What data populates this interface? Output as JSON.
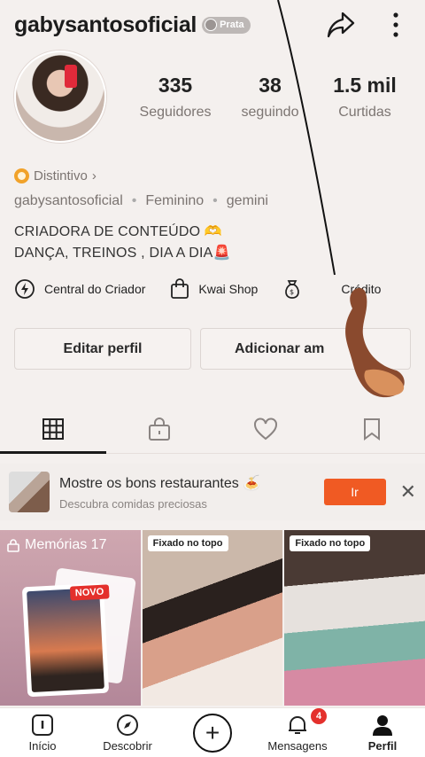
{
  "header": {
    "username": "gabysantosoficial",
    "badge": "Prata"
  },
  "stats": [
    {
      "value": "335",
      "label": "Seguidores"
    },
    {
      "value": "38",
      "label": "seguindo"
    },
    {
      "value": "1.5 mil",
      "label": "Curtidas"
    }
  ],
  "distintivo": "Distintivo",
  "meta": {
    "name": "gabysantosoficial",
    "gender": "Feminino",
    "sign": "gemini"
  },
  "bio": {
    "line1": "CRIADORA DE CONTEÚDO 🫶",
    "line2": "DANÇA, TREINOS , DIA A DIA🚨"
  },
  "shortcuts": [
    {
      "label": "Central do Criador"
    },
    {
      "label": "Kwai Shop"
    },
    {
      "label": "Crédito"
    }
  ],
  "buttons": {
    "edit": "Editar perfil",
    "add": "Adicionar am"
  },
  "promo": {
    "title": "Mostre os bons restaurantes 🍝",
    "subtitle": "Descubra comidas preciosas",
    "button": "Ir"
  },
  "grid": {
    "memories": {
      "label": "Memórias 17",
      "badge": "NOVO"
    },
    "pinned1": "Fixado no topo",
    "pinned2": "Fixado no topo"
  },
  "nav": {
    "home": "Início",
    "discover": "Descobrir",
    "messages": "Mensagens",
    "messages_badge": "4",
    "profile": "Perfil"
  }
}
